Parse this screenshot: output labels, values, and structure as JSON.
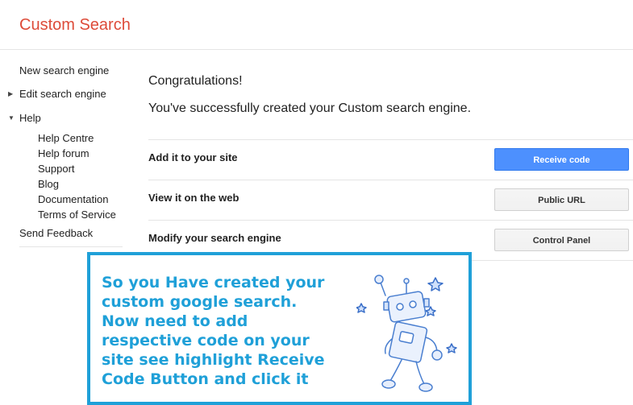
{
  "header": {
    "title": "Custom Search"
  },
  "sidebar": {
    "items": [
      {
        "label": "New search engine"
      },
      {
        "label": "Edit search engine"
      },
      {
        "label": "Help"
      },
      {
        "label": "Send Feedback"
      }
    ],
    "help_items": [
      {
        "label": "Help Centre"
      },
      {
        "label": "Help forum"
      },
      {
        "label": "Support"
      },
      {
        "label": "Blog"
      },
      {
        "label": "Documentation"
      },
      {
        "label": "Terms of Service"
      }
    ]
  },
  "main": {
    "congrats": "Congratulations!",
    "message": "You've successfully created your Custom search engine.",
    "rows": [
      {
        "label": "Add it to your site",
        "button": "Receive code"
      },
      {
        "label": "View it on the web",
        "button": "Public URL"
      },
      {
        "label": "Modify your search engine",
        "button": "Control Panel"
      }
    ]
  },
  "annotation": {
    "lines": [
      "So you Have created your",
      "custom google search.",
      "Now need to add",
      "respective code on your",
      "site see highlight Receive",
      "Code Button and click it"
    ],
    "border_color": "#1fa0d8",
    "text_color": "#1fa0d8"
  },
  "colors": {
    "brand": "#dd4b39",
    "primary_button": "#4d90fe"
  }
}
